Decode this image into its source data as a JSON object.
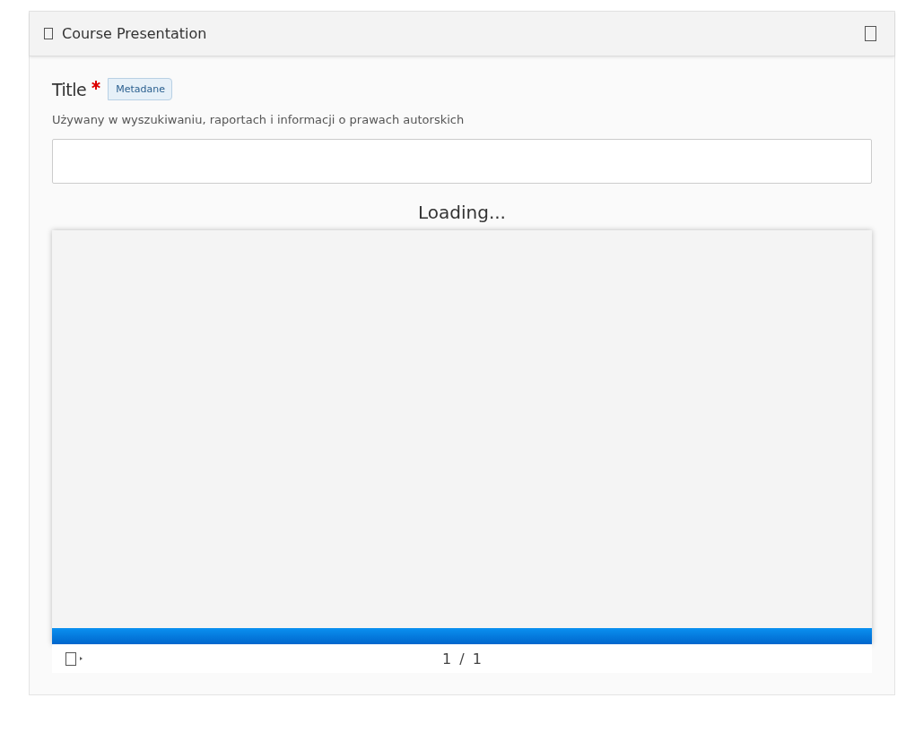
{
  "header": {
    "title": "Course Presentation"
  },
  "field": {
    "label": "Title",
    "required": true,
    "tag": "Metadane",
    "description": "Używany w wyszukiwaniu, raportach i informacji o prawach autorskich"
  },
  "status": "Loading...",
  "presentation": {
    "progress": {
      "level": 1
    },
    "footer": {
      "page": "1",
      "separator": "/",
      "total": "1"
    }
  }
}
